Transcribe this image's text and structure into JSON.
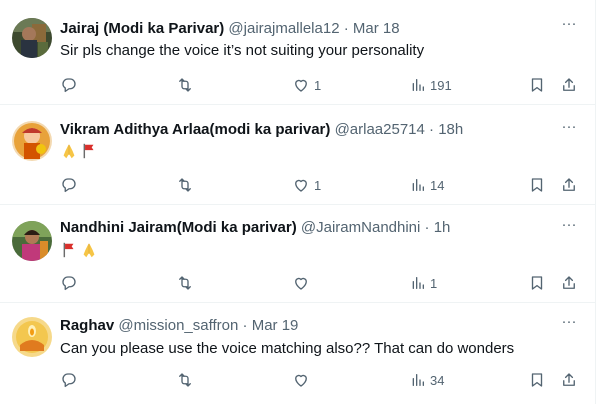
{
  "colors": {
    "text": "#0f1419",
    "secondary": "#536471",
    "divider": "#eff3f4",
    "background": "#ffffff"
  },
  "tweets": [
    {
      "author": "Jairaj (Modi ka Parivar)",
      "handle": "@jairajmallela12",
      "separator": "·",
      "time": "Mar 18",
      "text": "Sir pls change the voice it’s not suiting your personality",
      "emojis": [],
      "counts": {
        "reply": "",
        "repost": "",
        "like": "1",
        "views": "191"
      }
    },
    {
      "author": "Vikram Adithya Arlaa(modi ka parivar)",
      "handle": "@arlaa25714",
      "separator": "·",
      "time": "18h",
      "text": "",
      "emojis": [
        "folded-hands-emoji",
        "red-flag-emoji"
      ],
      "counts": {
        "reply": "",
        "repost": "",
        "like": "1",
        "views": "14"
      }
    },
    {
      "author": "Nandhini Jairam(Modi ka parivar)",
      "handle": "@JairamNandhini",
      "separator": "·",
      "time": "1h",
      "text": "",
      "emojis": [
        "red-flag-emoji",
        "folded-hands-emoji"
      ],
      "counts": {
        "reply": "",
        "repost": "",
        "like": "",
        "views": "1"
      }
    },
    {
      "author": "Raghav",
      "handle": "@mission_saffron",
      "separator": "·",
      "time": "Mar 19",
      "text": "Can you please use the voice matching also?? That can do wonders",
      "emojis": [],
      "counts": {
        "reply": "",
        "repost": "",
        "like": "",
        "views": "34"
      }
    }
  ],
  "icons": {
    "more": "more-dots-icon",
    "reply": "reply-bubble-icon",
    "repost": "repost-arrows-icon",
    "like": "heart-icon",
    "views": "views-bars-icon",
    "bookmark": "bookmark-icon",
    "share": "share-upload-icon"
  },
  "more_glyph": "···"
}
